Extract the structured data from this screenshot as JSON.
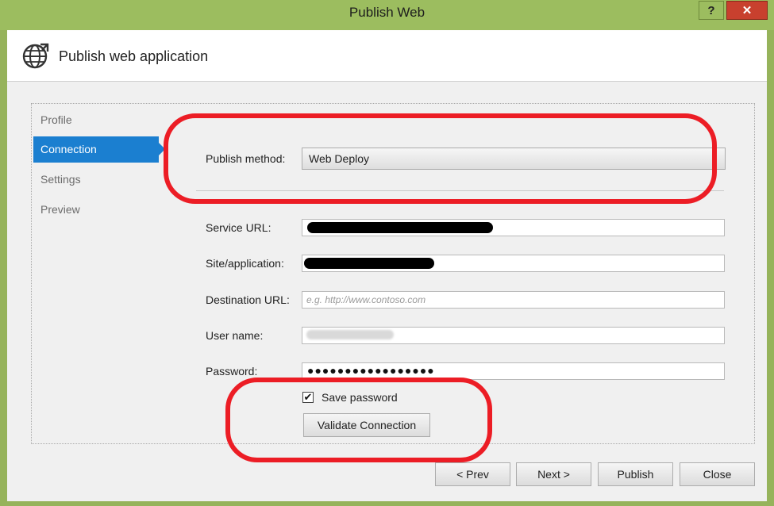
{
  "window": {
    "title": "Publish Web",
    "help_label": "?",
    "close_label": "✕"
  },
  "header": {
    "title": "Publish web application",
    "icon": "globe-publish-icon"
  },
  "nav": {
    "items": [
      {
        "label": "Profile",
        "active": false
      },
      {
        "label": "Connection",
        "active": true
      },
      {
        "label": "Settings",
        "active": false
      },
      {
        "label": "Preview",
        "active": false
      }
    ]
  },
  "form": {
    "publish_method_label": "Publish method:",
    "publish_method_value": "Web Deploy",
    "service_url_label": "Service URL:",
    "site_label": "Site/application:",
    "destination_url_label": "Destination URL:",
    "destination_url_placeholder": "e.g. http://www.contoso.com",
    "username_label": "User name:",
    "password_label": "Password:",
    "password_mask": "●●●●●●●●●●●●●●●●●",
    "save_password_label": "Save password",
    "save_password_checked": true,
    "validate_label": "Validate Connection"
  },
  "footer": {
    "prev_label": "< Prev",
    "next_label": "Next >",
    "publish_label": "Publish",
    "close_label": "Close"
  },
  "colors": {
    "titlebar": "#9cbd5f",
    "close_button": "#c8402e",
    "nav_active": "#1b7fd0",
    "annotation": "#ec1d25"
  }
}
